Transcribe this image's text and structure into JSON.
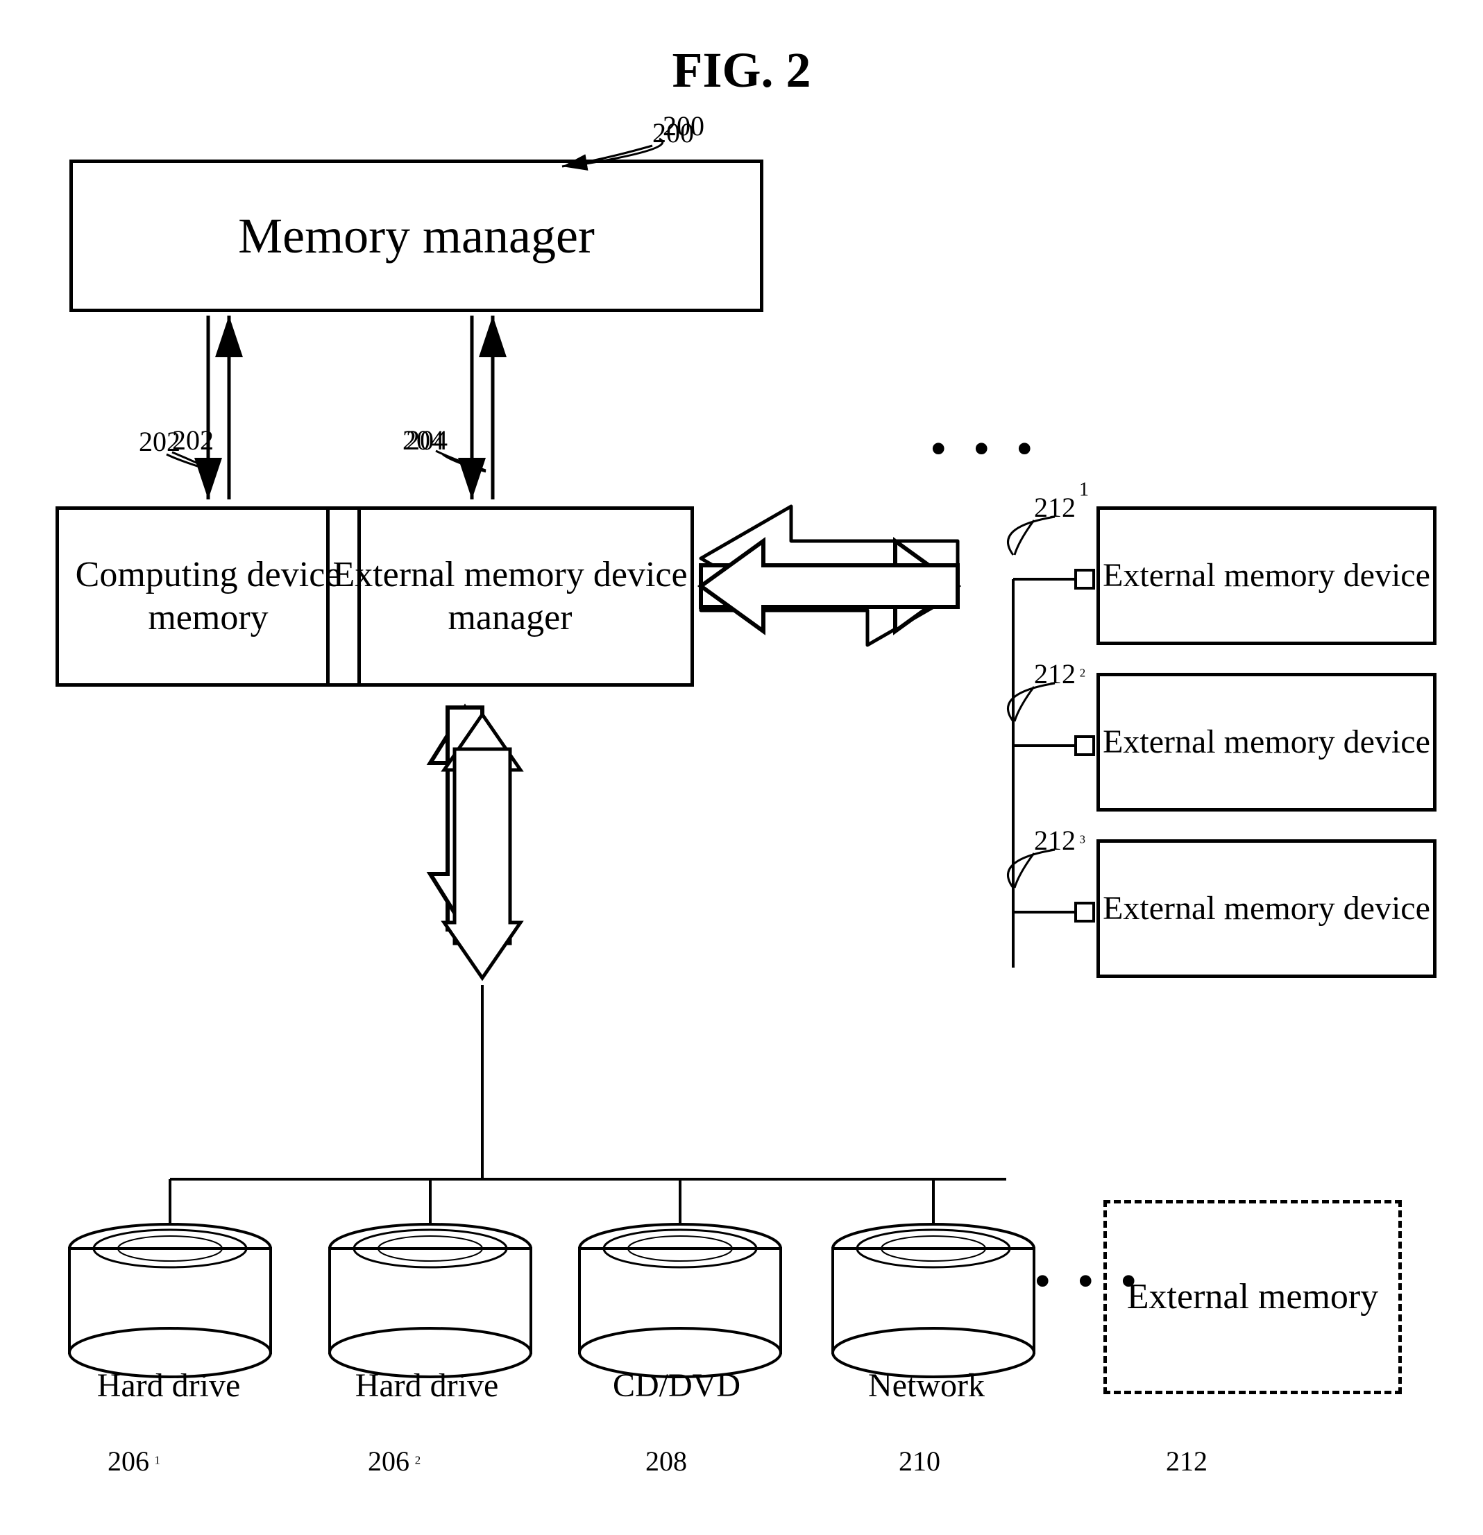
{
  "figure": {
    "title": "FIG. 2",
    "ref_200": "200",
    "ref_202": "202",
    "ref_204": "204",
    "ref_206_1": "206",
    "ref_206_1_sub": "1",
    "ref_206_2": "206",
    "ref_206_2_sub": "2",
    "ref_208": "208",
    "ref_210": "210",
    "ref_212": "212",
    "ref_212_1": "212",
    "ref_212_1_sub": "1",
    "ref_212_2": "212",
    "ref_212_2_sub": "2",
    "ref_212_3": "212",
    "ref_212_3_sub": "3"
  },
  "boxes": {
    "memory_manager": "Memory manager",
    "computing_device_memory": "Computing device memory",
    "external_memory_device_manager": "External memory device manager",
    "external_memory_device_1": "External memory device",
    "external_memory_device_2": "External memory device",
    "external_memory_device_3": "External memory device",
    "external_memory": "External memory"
  },
  "storage": {
    "hard_drive_1": "Hard drive",
    "hard_drive_2": "Hard drive",
    "cd_dvd": "CD/DVD",
    "network": "Network"
  },
  "dots": "• • •"
}
